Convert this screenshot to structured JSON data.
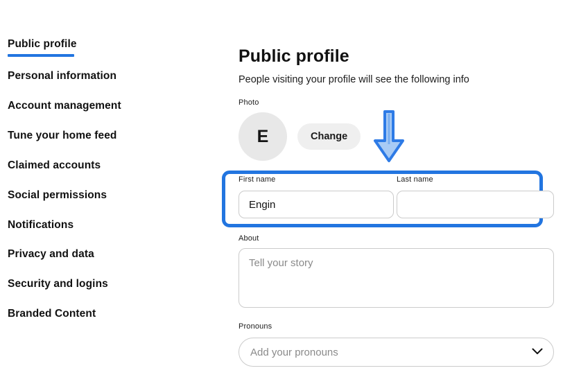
{
  "sidebar": {
    "active_index": 0,
    "accent_color": "#2275E0",
    "items": [
      {
        "label": "Public profile"
      },
      {
        "label": "Personal information"
      },
      {
        "label": "Account management"
      },
      {
        "label": "Tune your home feed"
      },
      {
        "label": "Claimed accounts"
      },
      {
        "label": "Social permissions"
      },
      {
        "label": "Notifications"
      },
      {
        "label": "Privacy and data"
      },
      {
        "label": "Security and logins"
      },
      {
        "label": "Branded Content"
      }
    ]
  },
  "main": {
    "title": "Public profile",
    "subtitle": "People visiting your profile will see the following info",
    "photo": {
      "label": "Photo",
      "avatar_initial": "E",
      "avatar_background": "#E8E8E8",
      "change_button_label": "Change"
    },
    "first_name": {
      "label": "First name",
      "value": "Engin",
      "placeholder": ""
    },
    "last_name": {
      "label": "Last name",
      "value": "",
      "placeholder": ""
    },
    "about": {
      "label": "About",
      "value": "",
      "placeholder": "Tell your story"
    },
    "pronouns": {
      "label": "Pronouns",
      "selected": "Add your pronouns",
      "chevron_icon": "chevron-down-icon"
    }
  },
  "annotations": {
    "highlight_box": {
      "target": "name-fields",
      "color": "#2275E0",
      "shape": "rounded-rectangle"
    },
    "arrow": {
      "icon_name": "down-arrow-annotation",
      "direction": "down",
      "stroke_color": "#2E7BE6",
      "fill_color": "#A8CBF5"
    }
  }
}
